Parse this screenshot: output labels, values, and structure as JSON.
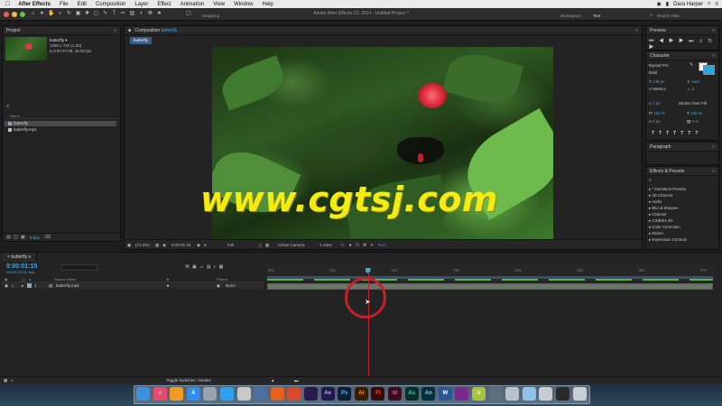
{
  "menubar": {
    "apple": "",
    "items": [
      "After Effects",
      "File",
      "Edit",
      "Composition",
      "Layer",
      "Effect",
      "Animation",
      "View",
      "Window",
      "Help"
    ],
    "user": "Dara Harper"
  },
  "window": {
    "title": "Adobe After Effects CC 2014 - Untitled Project *",
    "snapping_label": "Snapping",
    "workspace_label": "Workspace:",
    "workspace_value": "Text",
    "search_help_placeholder": "Search Help"
  },
  "project": {
    "tab": "Project",
    "comp_name": "butterfly ▾",
    "comp_info_1": "1280 x 720 (1.00)",
    "comp_info_2": "Δ 0:00:07:08, 25.00 fps",
    "search_icon": "⌕",
    "col_name": "Name",
    "items": [
      "butterfly",
      "butterfly.mp4"
    ],
    "bpc": "8 bpc"
  },
  "composition": {
    "tab_prefix": "Composition",
    "tab_name": "butterfly",
    "breadcrumb": "butterfly",
    "zoom": "(71.3%)",
    "timecode": "0:00:01:15",
    "resolution": "Full",
    "camera": "Active Camera",
    "views": "1 View",
    "exposure": "+0.0"
  },
  "watermark": "www.cgtsj.com",
  "preview": {
    "tab": "Preview"
  },
  "character": {
    "tab": "Character",
    "font": "Myriad Pro",
    "style": "Bold",
    "size": "148 px",
    "leading": "Auto",
    "kerning": "Metrics",
    "tracking": "0",
    "stroke_width": "7 px",
    "stroke_mode": "Stroke Over Fill",
    "vscale": "100 %",
    "hscale": "145 %",
    "baseline": "0 px",
    "tsume": "0 %",
    "fill_color": "#f2f2f2",
    "stroke_color": "#29a8e0"
  },
  "paragraph": {
    "tab": "Paragraph"
  },
  "effects": {
    "tab": "Effects & Presets",
    "items": [
      "* Animation Presets",
      "3D Channel",
      "Audio",
      "Blur & Sharpen",
      "Channel",
      "CINEMA 4D",
      "Color Correction",
      "Distort",
      "Expression Controls"
    ]
  },
  "timeline": {
    "tab": "butterfly",
    "timecode": "0:00:01:15",
    "fps": "00040 (25.00 fps)",
    "col_source": "Source Name",
    "col_parent": "Parent",
    "layer": {
      "index": "1",
      "name": "butterfly.mp4",
      "parent": "None"
    },
    "ticks": [
      "00s",
      "01s",
      "02s",
      "03s",
      "04s",
      "05s",
      "06s",
      "07s"
    ],
    "current_fraction": 0.226,
    "toggle_label": "Toggle Switches / Modes"
  },
  "dock": {
    "icons": [
      {
        "name": "finder-icon",
        "color": "#3d8fe0",
        "glyph": ""
      },
      {
        "name": "itunes-icon",
        "color": "#e64a6d",
        "glyph": "♫"
      },
      {
        "name": "ibooks-icon",
        "color": "#f29a26",
        "glyph": ""
      },
      {
        "name": "appstore-icon",
        "color": "#2d8ef0",
        "glyph": "A"
      },
      {
        "name": "launchpad-icon",
        "color": "#9aa3ad",
        "glyph": ""
      },
      {
        "name": "safari-icon",
        "color": "#2f9ff0",
        "glyph": ""
      },
      {
        "name": "app-icon",
        "color": "#c8c8c8",
        "glyph": ""
      },
      {
        "name": "quicktime-icon",
        "color": "#4a6fa0",
        "glyph": ""
      },
      {
        "name": "firefox-icon",
        "color": "#e8601c",
        "glyph": ""
      },
      {
        "name": "app-icon-2",
        "color": "#d84a2a",
        "glyph": ""
      },
      {
        "name": "premiere-icon",
        "color": "#2a1a4e",
        "glyph": ""
      },
      {
        "name": "aftereffects-icon",
        "color": "#1e1a4e",
        "glyph": "Ae"
      },
      {
        "name": "photoshop-icon",
        "color": "#0f1e33",
        "glyph": "Ps"
      },
      {
        "name": "illustrator-icon",
        "color": "#3a1c00",
        "glyph": "Ai"
      },
      {
        "name": "flash-icon",
        "color": "#3a0a0a",
        "glyph": "Fl"
      },
      {
        "name": "indesign-icon",
        "color": "#3c0c1e",
        "glyph": "Id"
      },
      {
        "name": "audition-icon",
        "color": "#00302a",
        "glyph": "Au"
      },
      {
        "name": "animate-icon",
        "color": "#00323a",
        "glyph": "An"
      },
      {
        "name": "word-icon",
        "color": "#2b5797",
        "glyph": "W"
      },
      {
        "name": "app-icon-3",
        "color": "#7a2a8a",
        "glyph": ""
      },
      {
        "name": "ultraedit-icon",
        "color": "#a6c33a",
        "glyph": "U"
      },
      {
        "name": "app-icon-4",
        "color": "#5a6f80",
        "glyph": ""
      },
      {
        "name": "app-icon-5",
        "color": "#b8c4cc",
        "glyph": ""
      },
      {
        "name": "folder-icon",
        "color": "#8ec3ea",
        "glyph": ""
      },
      {
        "name": "folder-icon-2",
        "color": "#c8ccd0",
        "glyph": ""
      },
      {
        "name": "terminal-icon",
        "color": "#2a2a2a",
        "glyph": ""
      },
      {
        "name": "trash-icon",
        "color": "#c9cfd4",
        "glyph": ""
      }
    ]
  }
}
